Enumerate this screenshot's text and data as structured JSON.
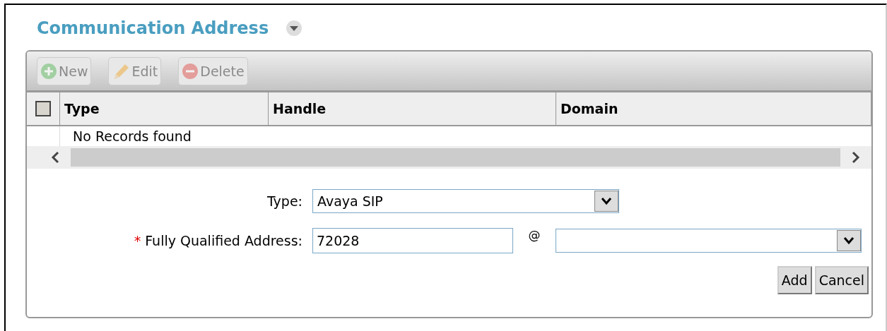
{
  "title": "Communication Address",
  "toolbar": [
    {
      "label": "New",
      "kind": "new",
      "disabled": true
    },
    {
      "label": "Edit",
      "kind": "edit",
      "disabled": true
    },
    {
      "label": "Delete",
      "kind": "delete",
      "disabled": true
    }
  ],
  "table": {
    "select_all": {
      "checked": false
    },
    "columns": [
      "Type",
      "Handle",
      "Domain"
    ],
    "empty_message": "No Records found"
  },
  "form": {
    "type": {
      "label": "Type:",
      "value": "Avaya SIP"
    },
    "address": {
      "label": "Fully Qualified Address:",
      "required": true,
      "required_mark": "*",
      "value": "72028",
      "separator": "@"
    }
  },
  "buttons": [
    "Add",
    "Cancel"
  ]
}
